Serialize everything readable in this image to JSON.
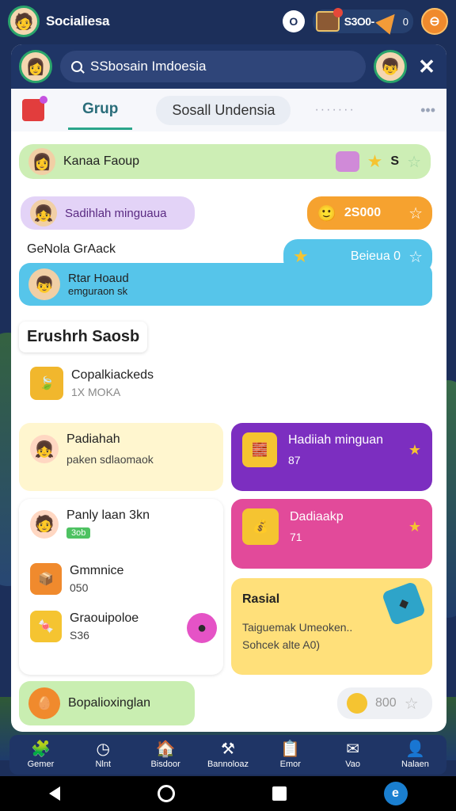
{
  "app": {
    "title": "Socialiesa"
  },
  "status": {
    "left_icon": "O",
    "coins": "S3O0-",
    "small_value": "0"
  },
  "header": {
    "search_text": "SSbosain Imdoesia"
  },
  "tabs": {
    "active": "Grup",
    "inactive": "Sosall Undensia"
  },
  "rows": {
    "group_row": {
      "label": "Kanaa Faoup",
      "value": "S"
    },
    "weekly_row": {
      "label": "Sadihlah minguaua",
      "value": "2S000"
    },
    "generic_label": "GeNola GrAack",
    "friend_row": {
      "name": "Rtar Hoaud",
      "sub": "emguraon sk",
      "pill": "Beieua 0"
    }
  },
  "section": {
    "title": "Erushrh Saosb"
  },
  "items": {
    "item1": {
      "title": "Copalkiackeds",
      "sub": "1X MOKA"
    },
    "hadiah_left": {
      "title": "Padiahah",
      "sub": "paken sdlaomaok"
    },
    "hadiah_purple": {
      "title": "Hadiiah minguan",
      "sub": "87"
    },
    "pink_card": {
      "title": "Dadiaakp",
      "sub": "71"
    },
    "panly": {
      "title": "Panly laan 3kn",
      "badge": "3ob"
    },
    "gamnice": {
      "title": "Gmmnice",
      "sub": "050"
    },
    "graou": {
      "title": "Graouipoloe",
      "sub": "S36"
    },
    "yellow_card": {
      "title": "Rasial",
      "line1": "Taiguemak Umeoken..",
      "line2": "Sohcek alte A0)"
    },
    "bottom_row": {
      "title": "Bopalioxinglan",
      "value": "800"
    }
  },
  "nav": [
    {
      "label": "Gemer"
    },
    {
      "label": "Nlnt"
    },
    {
      "label": "Bisdoor"
    },
    {
      "label": "Bannoloaz"
    },
    {
      "label": "Emor"
    },
    {
      "label": "Vao"
    },
    {
      "label": "Nalaen"
    }
  ],
  "colors": {
    "bg": "#1c2f5a",
    "green_row": "#cdeeb5",
    "purple_pill": "#e3d3f7",
    "orange_pill": "#f6a22f",
    "blue_row": "#56c5ea",
    "cream_card": "#fff6cf",
    "purple_card": "#7c2ec0",
    "pink_card": "#e24a9a",
    "yellow_card": "#ffe07a"
  }
}
